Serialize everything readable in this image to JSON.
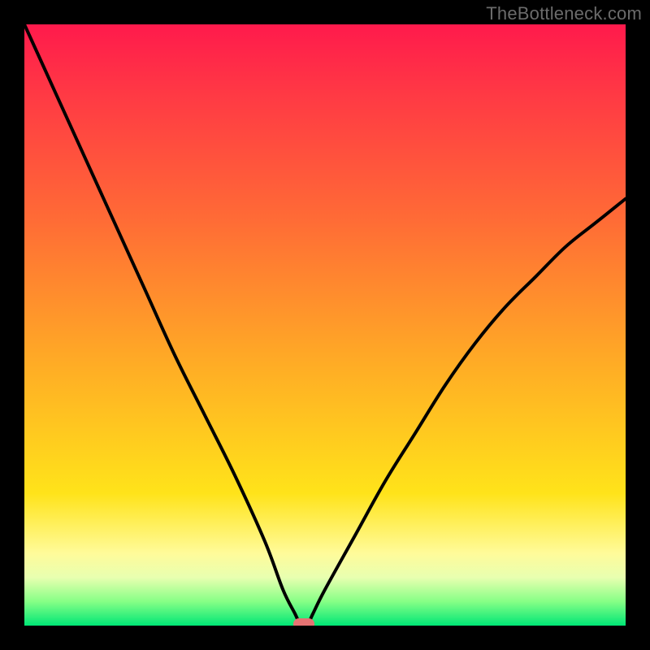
{
  "attribution": "TheBottleneck.com",
  "colors": {
    "frame_border": "#000000",
    "curve_stroke": "#000000",
    "trough_marker": "#e57373",
    "gradient_stops": [
      "#ff1a4c",
      "#ff3a44",
      "#ff6a36",
      "#ffa826",
      "#ffe31a",
      "#fffb9a",
      "#e8ffb0",
      "#86ff86",
      "#00e676"
    ]
  },
  "chart_data": {
    "type": "line",
    "title": "",
    "xlabel": "",
    "ylabel": "",
    "xlim": [
      0,
      100
    ],
    "ylim": [
      0,
      100
    ],
    "x": [
      0,
      5,
      10,
      15,
      20,
      25,
      30,
      35,
      40,
      43,
      45,
      46,
      47,
      48,
      50,
      55,
      60,
      65,
      70,
      75,
      80,
      85,
      90,
      95,
      100
    ],
    "values": [
      100,
      89,
      78,
      67,
      56,
      45,
      35,
      25,
      14,
      6,
      2,
      0,
      0,
      2,
      6,
      15,
      24,
      32,
      40,
      47,
      53,
      58,
      63,
      67,
      71
    ],
    "trough_x": 46.5,
    "trough_y": 0,
    "notes": "V-shaped bottleneck curve; minimum near x≈46 where bottleneck is ~0%. Left branch starts at 100% (top-left), right branch rises to ~71% at x=100. Values are estimated from pixel positions; no axis tick labels are shown in the source image."
  }
}
